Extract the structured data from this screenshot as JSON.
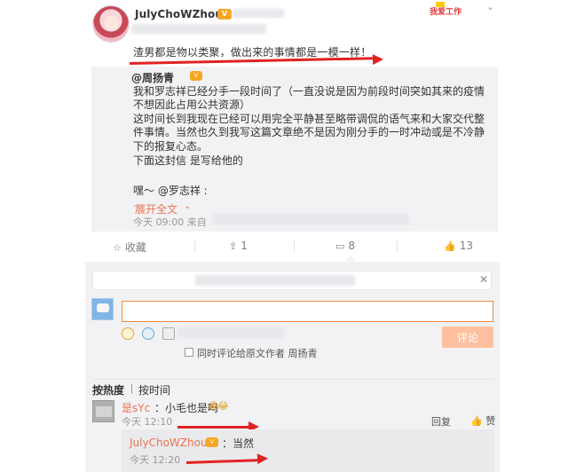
{
  "post": {
    "username": "JulyChoWZhou",
    "vip_badge": "V",
    "text": "渣男都是物以类聚，做出来的事情都是一模一样！",
    "watermark": "我爱工作",
    "menu_icon": "chevron-down-icon"
  },
  "repost": {
    "author": "@周扬青",
    "badge": "V",
    "lines": [
      "我和罗志祥已经分手一段时间了（一直没说是因为前段时间突如其来的疫情",
      "不想因此占用公共资源）",
      "这时间长到我现在已经可以用完全平静甚至略带调侃的语气来和大家交代整",
      "件事情。当然也久到我写这篇文章绝不是因为刚分手的一时冲动或是不冷静",
      "下的报复心态。",
      "下面这封信 是写给他的",
      "",
      "嘿～ @罗志祥 :",
      "..."
    ],
    "expand_label": "展开全文",
    "time": "今天 09:00 来自"
  },
  "actions": {
    "favorite_label": "收藏",
    "repost_count": "1",
    "comment_count": "8",
    "like_count": "13"
  },
  "comment_box": {
    "input_value": "",
    "submit_label": "评论",
    "also_comment_label": "同时评论给原文作者 周扬青"
  },
  "sort": {
    "hot_label": "按热度",
    "time_label": "按时间"
  },
  "comments": [
    {
      "name": "是sYc",
      "text": "：小毛也是吗",
      "emoji": "😂😂",
      "time": "今天 12:10",
      "reply_label": "回复",
      "like_label": "赞"
    },
    {
      "name": "JulyChoWZhou",
      "badge": "V",
      "text": "：当然",
      "time": "今天 12:20"
    }
  ],
  "colors": {
    "accent": "#eb7350",
    "arrow": "#e22222",
    "panel": "#f2f2f5",
    "submit": "#ffc09f"
  }
}
